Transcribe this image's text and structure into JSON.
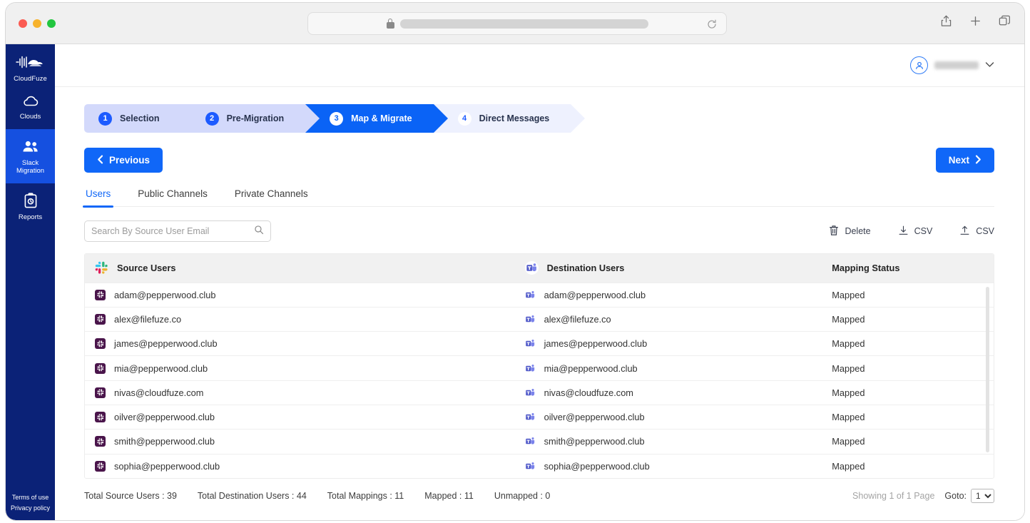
{
  "browser": {
    "url_redacted": true,
    "reload_icon": "reload-icon",
    "lock_icon": "lock-icon",
    "actions": [
      "share-icon",
      "new-tab-icon",
      "tab-overview-icon"
    ]
  },
  "sidebar": {
    "brand": "CloudFuze",
    "items": [
      {
        "label": "Clouds",
        "icon": "cloud-icon",
        "active": false
      },
      {
        "label": "Slack\nMigration",
        "label_line1": "Slack",
        "label_line2": "Migration",
        "icon": "users-icon",
        "active": true
      },
      {
        "label": "Reports",
        "icon": "clipboard-icon",
        "active": false
      }
    ],
    "legal": [
      {
        "label": "Terms of use"
      },
      {
        "label": "Privacy policy"
      }
    ]
  },
  "topbar": {
    "account_icon": "user-avatar-icon",
    "account_name": "",
    "caret_icon": "chevron-down-icon"
  },
  "stepper": {
    "steps": [
      {
        "num": "1",
        "label": "Selection",
        "state": "done"
      },
      {
        "num": "2",
        "label": "Pre-Migration",
        "state": "done"
      },
      {
        "num": "3",
        "label": "Map & Migrate",
        "state": "current"
      },
      {
        "num": "4",
        "label": "Direct Messages",
        "state": "todo"
      }
    ]
  },
  "nav": {
    "previous_label": "Previous",
    "next_label": "Next"
  },
  "tabs": [
    {
      "label": "Users",
      "active": true
    },
    {
      "label": "Public Channels",
      "active": false
    },
    {
      "label": "Private Channels",
      "active": false
    }
  ],
  "toolbar": {
    "search_placeholder": "Search By Source User Email",
    "search_value": "",
    "search_icon": "search-icon",
    "delete_label": "Delete",
    "download_csv_label": "CSV",
    "upload_csv_label": "CSV"
  },
  "table": {
    "headers": {
      "source": "Source Users",
      "destination": "Destination Users",
      "status": "Mapping Status"
    },
    "rows": [
      {
        "source": "adam@pepperwood.club",
        "destination": "adam@pepperwood.club",
        "status": "Mapped"
      },
      {
        "source": "alex@filefuze.co",
        "destination": "alex@filefuze.co",
        "status": "Mapped"
      },
      {
        "source": "james@pepperwood.club",
        "destination": "james@pepperwood.club",
        "status": "Mapped"
      },
      {
        "source": "mia@pepperwood.club",
        "destination": "mia@pepperwood.club",
        "status": "Mapped"
      },
      {
        "source": "nivas@cloudfuze.com",
        "destination": "nivas@cloudfuze.com",
        "status": "Mapped"
      },
      {
        "source": "oilver@pepperwood.club",
        "destination": "oilver@pepperwood.club",
        "status": "Mapped"
      },
      {
        "source": "smith@pepperwood.club",
        "destination": "smith@pepperwood.club",
        "status": "Mapped"
      },
      {
        "source": "sophia@pepperwood.club",
        "destination": "sophia@pepperwood.club",
        "status": "Mapped"
      }
    ]
  },
  "footer": {
    "total_source_users": "Total Source Users : 39",
    "total_destination_users": "Total Destination Users : 44",
    "total_mappings": "Total Mappings : 11",
    "mapped": "Mapped : 11",
    "unmapped": "Unmapped : 0",
    "showing": "Showing 1 of 1 Page",
    "goto_label": "Goto:",
    "goto_value": "1",
    "goto_options": [
      "1"
    ]
  },
  "colors": {
    "brand_blue": "#1067f8",
    "sidebar_navy": "#0b2277",
    "sidebar_active": "#1550e0",
    "slack_purple": "#4a154b",
    "teams_purple": "#5059c9",
    "step_done_bg": "#d3d9fb",
    "step_todo_bg": "#eef1fe"
  }
}
